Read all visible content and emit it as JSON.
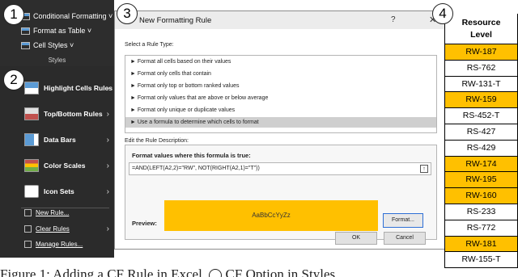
{
  "badges": [
    "1",
    "2",
    "3",
    "4"
  ],
  "ribbon": {
    "items": [
      "Conditional Formatting ˅",
      "Format as Table ˅",
      "Cell Styles ˅"
    ],
    "group_label": "Styles"
  },
  "menu": {
    "main_items": [
      "Highlight Cells Rules",
      "Top/Bottom Rules",
      "Data Bars",
      "Color Scales",
      "Icon Sets"
    ],
    "sub_items": [
      "New Rule...",
      "Clear Rules",
      "Manage Rules..."
    ],
    "arrow": "›"
  },
  "dialog": {
    "title": "New Formatting Rule",
    "help": "?",
    "close": "✕",
    "select_label": "Select a Rule Type:",
    "rule_types": [
      "► Format all cells based on their values",
      "► Format only cells that contain",
      "► Format only top or bottom ranked values",
      "► Format only values that are above or below average",
      "► Format only unique or duplicate values",
      "► Use a formula to determine which cells to format"
    ],
    "edit_label": "Edit the Rule Description:",
    "formula_header": "Format values where this formula is true:",
    "formula": "=AND(LEFT(A2,2)=\"RW\", NOT(RIGHT(A2,1)=\"T\"))",
    "preview_label": "Preview:",
    "preview_text": "AaBbCcYyZz",
    "format_button": "Format...",
    "ok_button": "OK",
    "cancel_button": "Cancel"
  },
  "column": {
    "header_line1": "Resource",
    "header_line2": "Level",
    "cells": [
      {
        "text": "RW-187",
        "highlight": true
      },
      {
        "text": "RS-762",
        "highlight": false
      },
      {
        "text": "RW-131-T",
        "highlight": false
      },
      {
        "text": "RW-159",
        "highlight": true
      },
      {
        "text": "RS-452-T",
        "highlight": false
      },
      {
        "text": "RS-427",
        "highlight": false
      },
      {
        "text": "RS-429",
        "highlight": false
      },
      {
        "text": "RW-174",
        "highlight": true
      },
      {
        "text": "RW-195",
        "highlight": true
      },
      {
        "text": "RW-160",
        "highlight": true
      },
      {
        "text": "RS-233",
        "highlight": false
      },
      {
        "text": "RS-772",
        "highlight": false
      },
      {
        "text": "RW-181",
        "highlight": true
      },
      {
        "text": "RW-155-T",
        "highlight": false
      }
    ]
  },
  "caption": {
    "before": "Figure 1: Adding a CF Rule in Excel.",
    "after": "CF Option in Styles"
  },
  "colors": {
    "highlight": "#ffc000",
    "dark_panel": "#2b2b2b"
  }
}
